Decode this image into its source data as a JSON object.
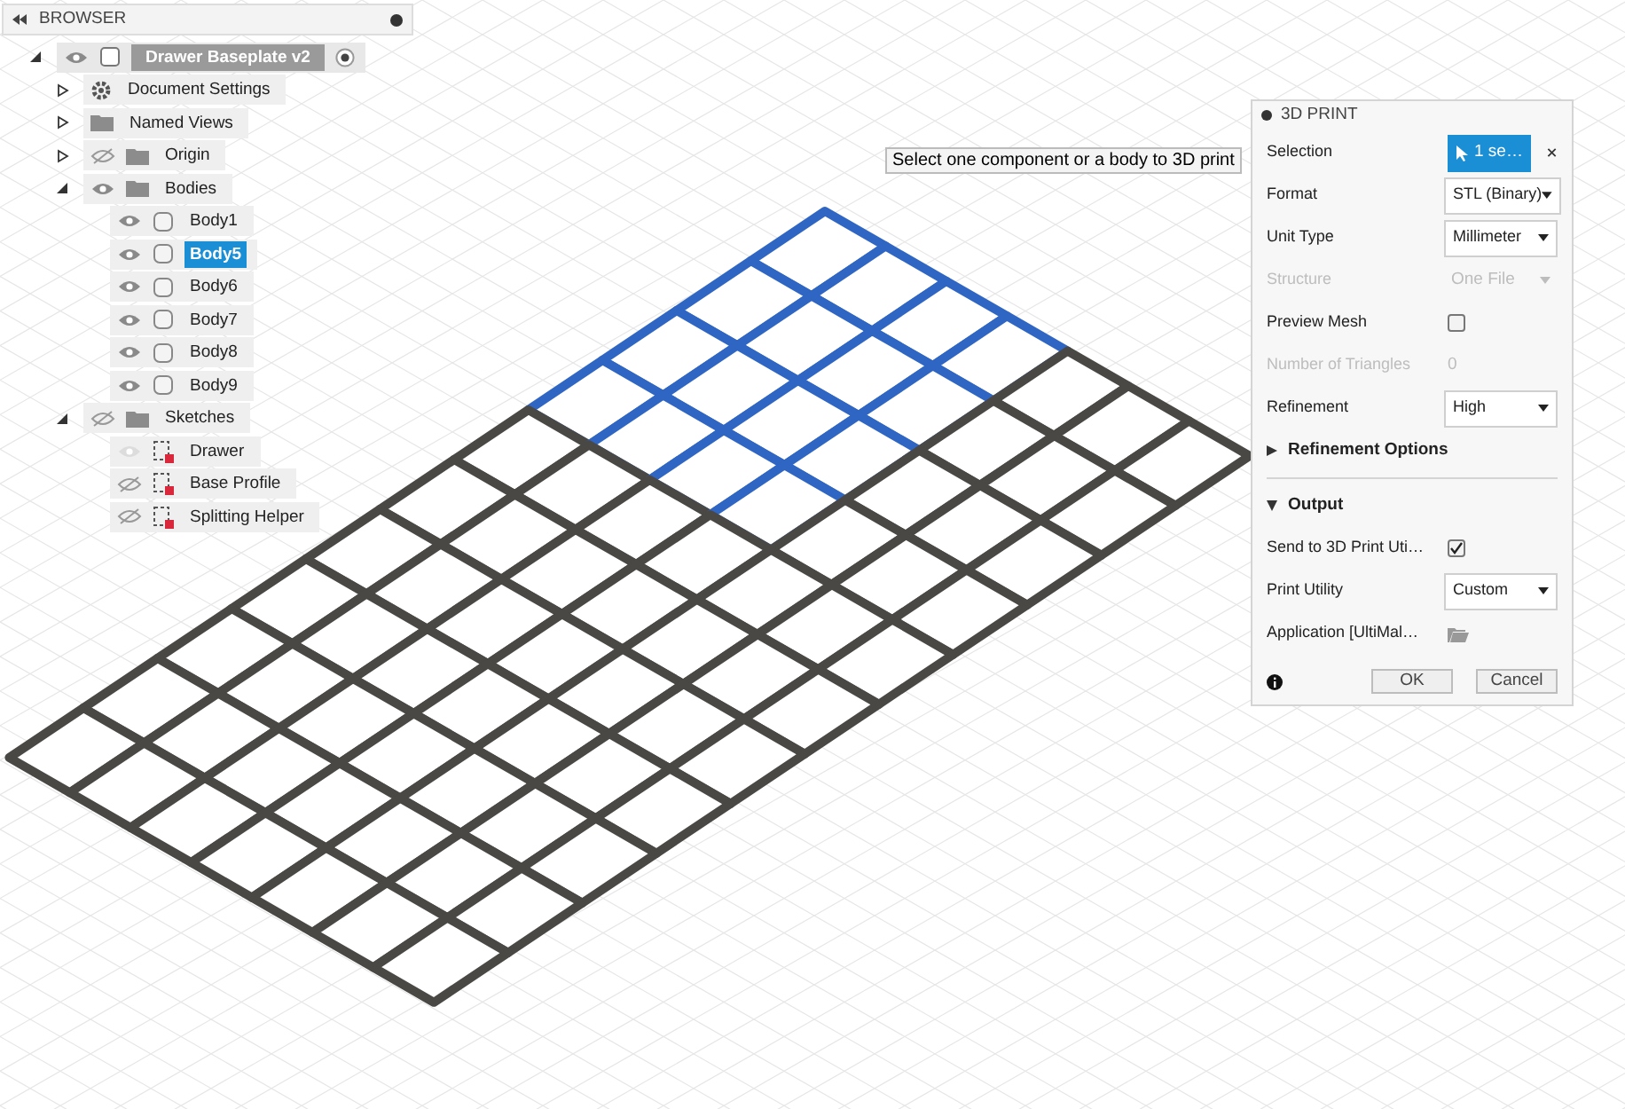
{
  "browser": {
    "title": "BROWSER",
    "items": [
      {
        "label": "Drawer Baseplate v2",
        "kind": "component",
        "visible": true,
        "expanded": true,
        "selected": false,
        "active": true,
        "children": [
          {
            "label": "Document Settings",
            "kind": "settings",
            "expanded": false,
            "selected": false
          },
          {
            "label": "Named Views",
            "kind": "folder",
            "expanded": false,
            "selected": false
          },
          {
            "label": "Origin",
            "kind": "folder",
            "visible": false,
            "expanded": false,
            "selected": false
          },
          {
            "label": "Bodies",
            "kind": "folder",
            "visible": true,
            "expanded": true,
            "selected": false,
            "children": [
              {
                "label": "Body1",
                "kind": "body",
                "visible": true,
                "selected": false
              },
              {
                "label": "Body5",
                "kind": "body",
                "visible": true,
                "selected": true
              },
              {
                "label": "Body6",
                "kind": "body",
                "visible": true,
                "selected": false
              },
              {
                "label": "Body7",
                "kind": "body",
                "visible": true,
                "selected": false
              },
              {
                "label": "Body8",
                "kind": "body",
                "visible": true,
                "selected": false
              },
              {
                "label": "Body9",
                "kind": "body",
                "visible": true,
                "selected": false
              }
            ]
          },
          {
            "label": "Sketches",
            "kind": "folder",
            "visible": false,
            "expanded": true,
            "selected": false,
            "children": [
              {
                "label": "Drawer",
                "kind": "sketch",
                "visible": true,
                "dimmed": true,
                "selected": false
              },
              {
                "label": "Base Profile",
                "kind": "sketch",
                "visible": false,
                "dimmed": false,
                "selected": false
              },
              {
                "label": "Splitting Helper",
                "kind": "sketch",
                "visible": false,
                "dimmed": false,
                "selected": false
              }
            ]
          }
        ]
      }
    ]
  },
  "tooltip": "Select one component or a body to 3D print",
  "dialog": {
    "title": "3D PRINT",
    "rows": [
      {
        "kind": "selection",
        "label": "Selection",
        "value": "1 se…",
        "disabled": false
      },
      {
        "kind": "dropdown",
        "label": "Format",
        "value": "STL (Binary)",
        "disabled": false
      },
      {
        "kind": "dropdown",
        "label": "Unit Type",
        "value": "Millimeter",
        "disabled": false
      },
      {
        "kind": "dropdown",
        "label": "Structure",
        "value": "One File",
        "disabled": true
      },
      {
        "kind": "checkbox",
        "label": "Preview Mesh",
        "checked": false,
        "disabled": false
      },
      {
        "kind": "readout",
        "label": "Number of Triangles",
        "value": "0",
        "disabled": true
      },
      {
        "kind": "dropdown",
        "label": "Refinement",
        "value": "High",
        "disabled": false
      },
      {
        "kind": "section",
        "label": "Refinement Options",
        "expanded": false
      },
      {
        "kind": "section",
        "label": "Output",
        "expanded": true
      },
      {
        "kind": "checkbox",
        "label": "Send to 3D Print Uti…",
        "checked": true,
        "disabled": false
      },
      {
        "kind": "dropdown",
        "label": "Print Utility",
        "value": "Custom",
        "disabled": false
      },
      {
        "kind": "folder",
        "label": "Application [UltiMal…",
        "disabled": false
      }
    ],
    "buttons": [
      {
        "label": "OK"
      },
      {
        "label": "Cancel"
      }
    ]
  }
}
